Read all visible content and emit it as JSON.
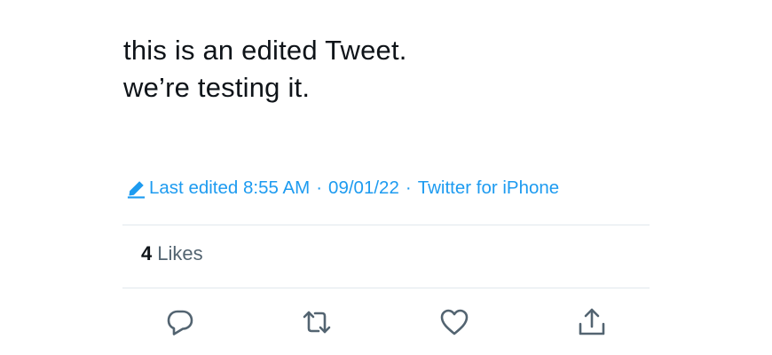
{
  "tweet": {
    "lines": [
      "this is an edited Tweet.",
      "we’re testing it."
    ]
  },
  "meta": {
    "edited_label": "Last edited 8:55 AM",
    "date": "09/01/22",
    "separator": "·",
    "source": "Twitter for iPhone",
    "accent_color": "#1d9bf0",
    "icon": "pencil-edit-icon"
  },
  "likes": {
    "count": "4",
    "label": "Likes"
  },
  "actions": {
    "icons": [
      "reply-icon",
      "retweet-icon",
      "like-heart-icon",
      "share-icon"
    ],
    "icon_color": "#536471"
  }
}
